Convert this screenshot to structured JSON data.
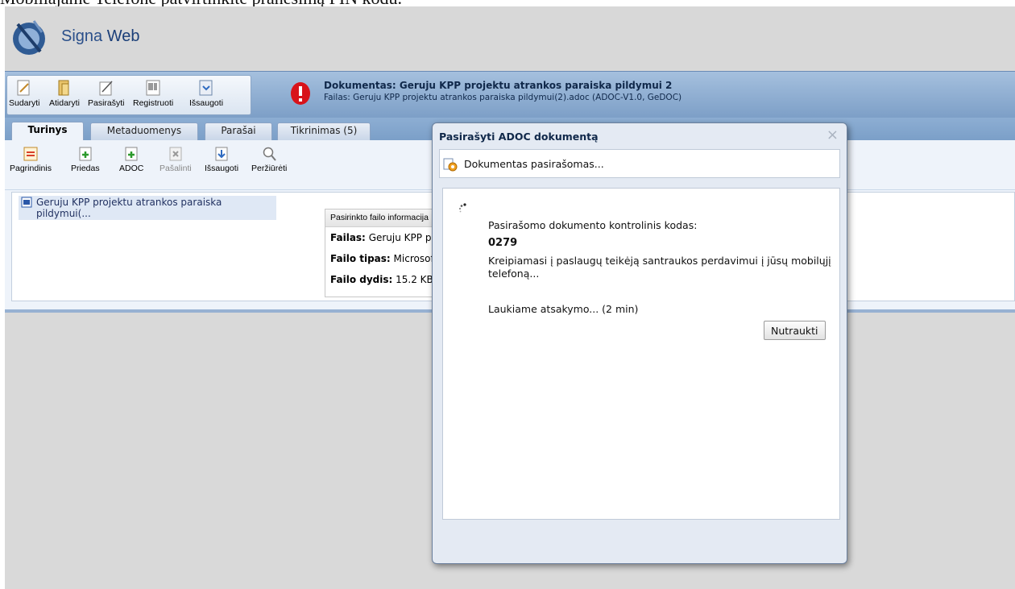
{
  "caption": "Mobiliajame Telefone patvirtinkite pranešimą PIN kodu.",
  "app": {
    "brand_part1": "Signa",
    "brand_part2": "Web"
  },
  "main_toolbar": [
    {
      "label": "Sudaryti",
      "icon": "compose-icon"
    },
    {
      "label": "Atidaryti",
      "icon": "open-icon"
    },
    {
      "label": "Pasirašyti",
      "icon": "sign-icon"
    },
    {
      "label": "Registruoti",
      "icon": "register-icon"
    },
    {
      "label": "Išsaugoti",
      "icon": "save-icon"
    }
  ],
  "document": {
    "title": "Dokumentas: Geruju KPP projektu atrankos paraiska pildymui 2",
    "file": "Failas: Geruju KPP projektu atrankos paraiska pildymui(2).adoc (ADOC-V1.0, GeDOC)"
  },
  "tabs": [
    {
      "label": "Turinys",
      "active": true
    },
    {
      "label": "Metaduomenys",
      "active": false
    },
    {
      "label": "Parašai",
      "active": false
    },
    {
      "label": "Tikrinimas (5)",
      "active": false
    }
  ],
  "content_toolbar": [
    {
      "label": "Pagrindinis",
      "icon": "main-file-icon",
      "disabled": false
    },
    {
      "label": "Priedas",
      "icon": "attachment-icon",
      "disabled": false
    },
    {
      "label": "ADOC",
      "icon": "adoc-icon",
      "disabled": false
    },
    {
      "label": "Pašalinti",
      "icon": "remove-icon",
      "disabled": true
    },
    {
      "label": "Išsaugoti",
      "icon": "save-icon",
      "disabled": false
    },
    {
      "label": "Peržiūrėti",
      "icon": "preview-icon",
      "disabled": false
    }
  ],
  "tree": {
    "item": "Geruju KPP projektu atrankos paraiska pildymui(..."
  },
  "file_info": {
    "header": "Pasirinkto failo informacija",
    "name_label": "Failas:",
    "name_value": "Geruju KPP projektu atrankos paraiska pildymui.docx",
    "type_label": "Failo tipas:",
    "type_value": "Microsoft Word",
    "size_label": "Failo dydis:",
    "size_value": "15.2 KB"
  },
  "dialog": {
    "title": "Pasirašyti ADOC dokumentą",
    "close": "×",
    "status": "Dokumentas pasirašomas...",
    "code_label": "Pasirašomo dokumento kontrolinis kodas:",
    "code": "0279",
    "message": "Kreipiamasi į paslaugų teikėją santraukos perdavimui į jūsų mobilųjį telefoną...",
    "waiting": "Laukiame atsakymo... (2 min)",
    "cancel": "Nutraukti"
  }
}
